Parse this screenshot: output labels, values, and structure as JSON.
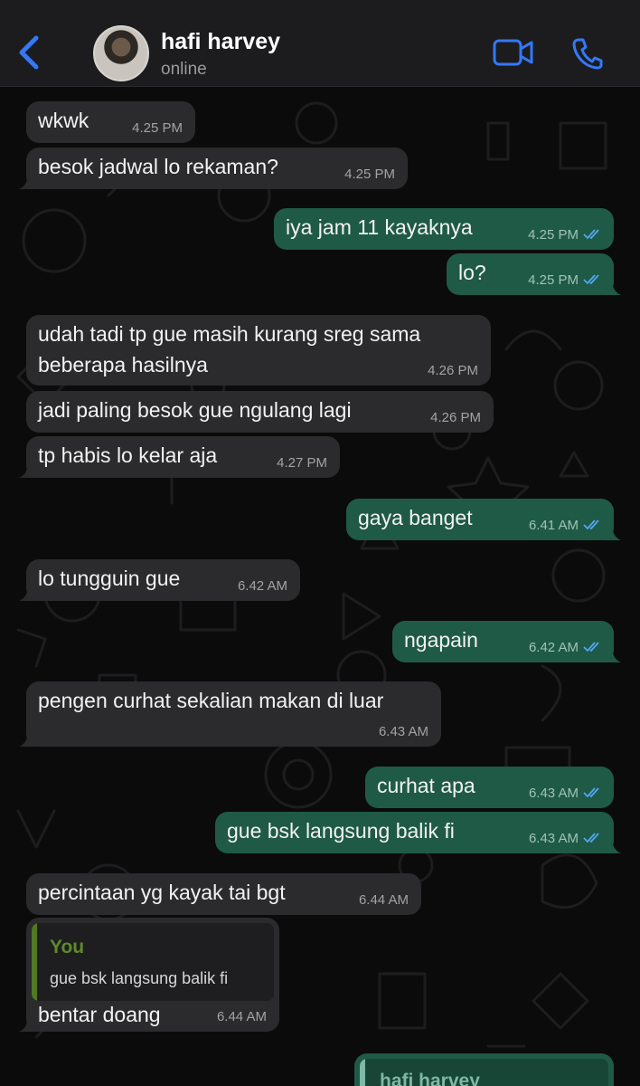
{
  "header": {
    "contact_name": "hafi harvey",
    "status": "online"
  },
  "colors": {
    "accent": "#3478f6",
    "incoming_bubble": "#2b2b2d",
    "outgoing_bubble": "#1f5a47",
    "read_ticks": "#53a6f2",
    "background": "#0b0b0b"
  },
  "messages": [
    {
      "direction": "in",
      "text": "wkwk",
      "time": "4.25 PM"
    },
    {
      "direction": "in",
      "text": "besok jadwal lo rekaman?",
      "time": "4.25 PM"
    },
    {
      "direction": "out",
      "text": "iya jam 11 kayaknya",
      "time": "4.25 PM",
      "status": "read"
    },
    {
      "direction": "out",
      "text": "lo?",
      "time": "4.25 PM",
      "status": "read"
    },
    {
      "direction": "in",
      "text": "udah tadi tp gue masih kurang sreg sama beberapa hasilnya",
      "line1": "udah tadi tp gue masih kurang sreg sama",
      "line2": "beberapa hasilnya",
      "time": "4.26 PM"
    },
    {
      "direction": "in",
      "text": "jadi paling besok gue ngulang lagi",
      "time": "4.26 PM"
    },
    {
      "direction": "in",
      "text": "tp habis lo kelar aja",
      "time": "4.27 PM"
    },
    {
      "direction": "out",
      "text": "gaya banget",
      "time": "6.41 AM",
      "status": "read"
    },
    {
      "direction": "in",
      "text": "lo tungguin gue",
      "time": "6.42 AM"
    },
    {
      "direction": "out",
      "text": "ngapain",
      "time": "6.42 AM",
      "status": "read"
    },
    {
      "direction": "in",
      "text": "pengen curhat sekalian makan di luar",
      "time": "6.43 AM"
    },
    {
      "direction": "out",
      "text": "curhat apa",
      "time": "6.43 AM",
      "status": "read"
    },
    {
      "direction": "out",
      "text": "gue bsk langsung balik fi",
      "time": "6.43 AM",
      "status": "read"
    },
    {
      "direction": "in",
      "text": "percintaan yg kayak tai bgt",
      "time": "6.44 AM"
    },
    {
      "direction": "in",
      "text": "bentar doang",
      "time": "6.44 AM",
      "reply": {
        "author": "You",
        "text": "gue bsk langsung balik fi"
      }
    },
    {
      "direction": "out",
      "text": "",
      "reply": {
        "author": "hafi harvey"
      }
    }
  ]
}
